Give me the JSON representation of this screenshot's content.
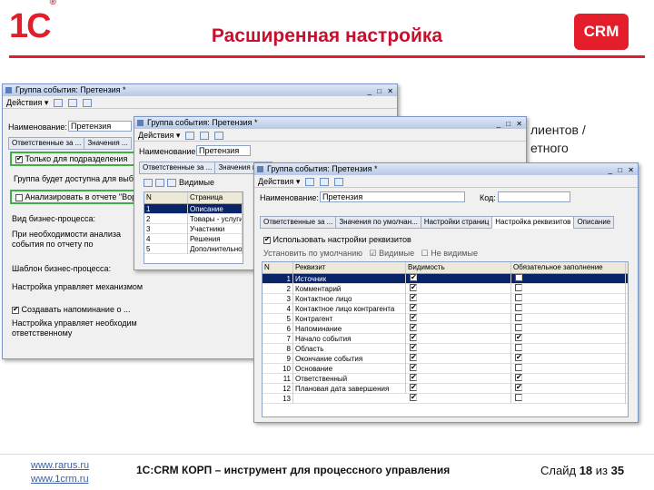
{
  "header": {
    "logo": "1С",
    "title": "Расширенная настройка",
    "crm_badge": "CRM"
  },
  "background_text": [
    "лиентов /",
    "етного"
  ],
  "window1": {
    "title": "Группа события: Претензия *",
    "menu": "Действия ▾",
    "name_label": "Наименование:",
    "name_value": "Претензия",
    "tabs": [
      "Ответственные за ...",
      "Значения ..."
    ],
    "checkbox1": "Только для подразделения",
    "hint1": "Группа будет доступна для выбора",
    "checkbox2": "Анализировать в отчете \"Вори...",
    "line1": "Вид бизнес-процесса:",
    "line2": "При необходимости анализа",
    "line3": "события по отчету по",
    "line4": "Шаблон бизнес-процесса:",
    "line5": "Настройка управляет механизмом",
    "checkbox3": "Создавать напоминание о ...",
    "line6": "Настройка управляет необходим",
    "line7": "ответственному"
  },
  "window2": {
    "title": "Группа события: Претензия *",
    "menu": "Действия ▾",
    "name_label": "Наименование:",
    "name_value": "Претензия",
    "tabs": [
      "Ответственные за ...",
      "Значения по ..."
    ],
    "grid_cols": [
      "N",
      "Страница"
    ],
    "grid_rows": [
      {
        "n": "1",
        "v": "Описание"
      },
      {
        "n": "2",
        "v": "Товары - услуги"
      },
      {
        "n": "3",
        "v": "Участники"
      },
      {
        "n": "4",
        "v": "Решения"
      },
      {
        "n": "5",
        "v": "Дополнительно"
      }
    ],
    "visible_label": "Видимые"
  },
  "window3": {
    "title": "Группа события: Претензия *",
    "menu": "Действия ▾",
    "name_label": "Наименование:",
    "name_value": "Претензия",
    "code_label": "Код:",
    "code_value": "",
    "tabs": [
      "Ответственные за ...",
      "Значения по умолчан...",
      "Настройки страниц",
      "Настройка реквизитов",
      "Описание"
    ],
    "use_settings": "Использовать настройки реквизитов",
    "toolbar": [
      "Установить по умолчанию",
      "Видимые",
      "Не видимые"
    ],
    "cols": [
      "N",
      "Реквизит",
      "Видимость",
      "Обязательное заполнение"
    ],
    "rows": [
      {
        "n": "1",
        "name": "Источник",
        "vis": true,
        "req": false
      },
      {
        "n": "2",
        "name": "Комментарий",
        "vis": true,
        "req": false
      },
      {
        "n": "3",
        "name": "Контактное лицо",
        "vis": true,
        "req": false
      },
      {
        "n": "4",
        "name": "Контактное лицо контрагента",
        "vis": true,
        "req": false
      },
      {
        "n": "5",
        "name": "Контрагент",
        "vis": true,
        "req": false
      },
      {
        "n": "6",
        "name": "Напоминание",
        "vis": true,
        "req": false
      },
      {
        "n": "7",
        "name": "Начало события",
        "vis": true,
        "req": true
      },
      {
        "n": "8",
        "name": "Область",
        "vis": true,
        "req": false
      },
      {
        "n": "9",
        "name": "Окончание события",
        "vis": true,
        "req": true
      },
      {
        "n": "10",
        "name": "Основание",
        "vis": true,
        "req": false
      },
      {
        "n": "11",
        "name": "Ответственный",
        "vis": true,
        "req": true
      },
      {
        "n": "12",
        "name": "Плановая дата завершения",
        "vis": true,
        "req": true
      },
      {
        "n": "13",
        "name": "",
        "vis": true,
        "req": false
      }
    ]
  },
  "footer": {
    "site1": "www.rarus.ru",
    "site2": "www.1crm.ru",
    "text": "1С:CRM КОРП – инструмент для процессного управления",
    "slide_label": "Слайд",
    "slide_num": "18",
    "slide_of": "из",
    "slide_total": "35"
  }
}
